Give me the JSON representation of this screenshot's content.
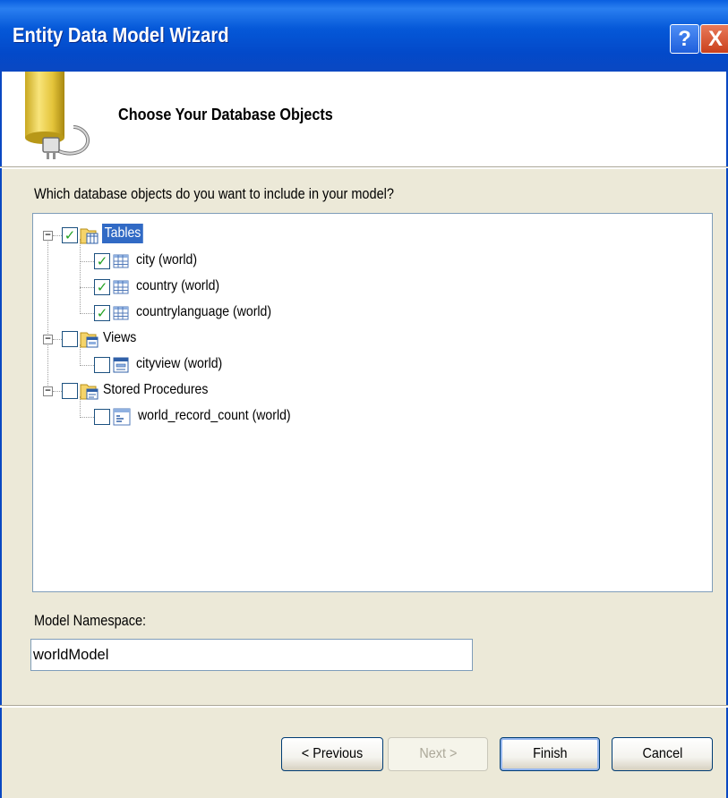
{
  "window": {
    "title": "Entity Data Model Wizard",
    "help_glyph": "?",
    "close_glyph": "X",
    "title_bar_color": "#0553d4"
  },
  "header": {
    "title": "Choose Your Database Objects",
    "icon": "database-plug-icon"
  },
  "body": {
    "question": "Which database objects do you want to include in your model?",
    "tree": [
      {
        "label": "Tables",
        "checked": true,
        "expanded": true,
        "selected": true,
        "icon": "tables-folder-icon",
        "children": [
          {
            "label": "city (world)",
            "checked": true,
            "icon": "table-icon"
          },
          {
            "label": "country (world)",
            "checked": true,
            "icon": "table-icon"
          },
          {
            "label": "countrylanguage (world)",
            "checked": true,
            "icon": "table-icon"
          }
        ]
      },
      {
        "label": "Views",
        "checked": false,
        "expanded": true,
        "icon": "views-folder-icon",
        "children": [
          {
            "label": "cityview (world)",
            "checked": false,
            "icon": "view-icon"
          }
        ]
      },
      {
        "label": "Stored Procedures",
        "checked": false,
        "expanded": true,
        "icon": "procedures-folder-icon",
        "children": [
          {
            "label": "world_record_count (world)",
            "checked": false,
            "icon": "procedure-icon"
          }
        ]
      }
    ],
    "namespace_label": "Model Namespace:",
    "namespace_value": "worldModel"
  },
  "buttons": {
    "previous": "< Previous",
    "next": "Next >",
    "finish": "Finish",
    "cancel": "Cancel"
  },
  "colors": {
    "selection": "#316ac5",
    "check": "#21a121",
    "dialog_bg": "#ece9d8"
  }
}
